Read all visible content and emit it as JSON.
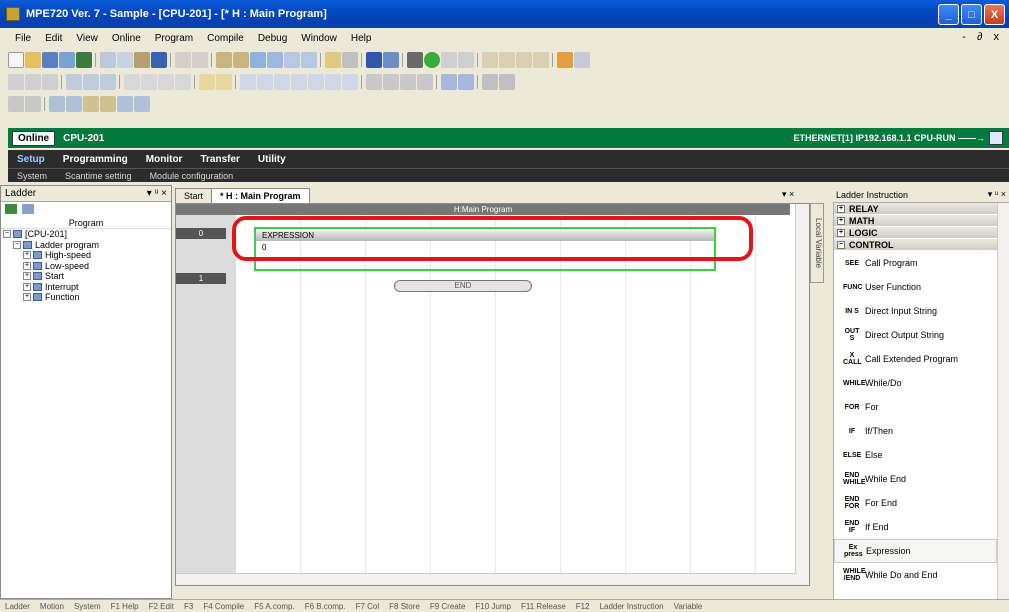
{
  "window": {
    "title": "MPE720 Ver. 7 - Sample - [CPU-201] - [* H : Main Program]",
    "min": "_",
    "max": "□",
    "close": "X"
  },
  "menu": {
    "items": [
      "File",
      "Edit",
      "View",
      "Online",
      "Program",
      "Compile",
      "Debug",
      "Window",
      "Help"
    ],
    "mdi_controls": "- ∂ x"
  },
  "online": {
    "button": "Online",
    "cpu": "CPU-201",
    "status": "ETHERNET[1] IP192.168.1.1 CPU-RUN ——→"
  },
  "main_tabs": [
    "Setup",
    "Programming",
    "Monitor",
    "Transfer",
    "Utility"
  ],
  "sub_tabs": [
    "System",
    "Scantime setting",
    "Module configuration"
  ],
  "ladder_panel": {
    "title": "Ladder",
    "pin": "▾ ᵘ ×",
    "program_label": "Program",
    "tree": [
      {
        "label": "[CPU-201]",
        "depth": 0
      },
      {
        "label": "Ladder program",
        "depth": 1
      },
      {
        "label": "High-speed",
        "depth": 2
      },
      {
        "label": "Low-speed",
        "depth": 2
      },
      {
        "label": "Start",
        "depth": 2
      },
      {
        "label": "Interrupt",
        "depth": 2
      },
      {
        "label": "Function",
        "depth": 2
      }
    ]
  },
  "doc_tabs": [
    "Start",
    "* H : Main Program"
  ],
  "doc_close": "▾ ×",
  "editor": {
    "header": "H:Main Program",
    "rung0": "0",
    "rung1": "1",
    "expression_label": "EXPRESSION",
    "expression_body": "0",
    "end_label": "END",
    "local_var_tab": "Local Variable"
  },
  "instruction_panel": {
    "title": "Ladder Instruction",
    "pin": "▾ ᵘ ×",
    "categories": [
      {
        "sign": "+",
        "name": "RELAY"
      },
      {
        "sign": "+",
        "name": "MATH"
      },
      {
        "sign": "+",
        "name": "LOGIC"
      },
      {
        "sign": "−",
        "name": "CONTROL"
      }
    ],
    "items": [
      {
        "icon": "SEE",
        "label": "Call Program"
      },
      {
        "icon": "FUNC",
        "label": "User Function"
      },
      {
        "icon": "IN S",
        "label": "Direct Input String"
      },
      {
        "icon": "OUT S",
        "label": "Direct Output String"
      },
      {
        "icon": "X CALL",
        "label": "Call Extended Program"
      },
      {
        "icon": "WHILE",
        "label": "While/Do"
      },
      {
        "icon": "FOR",
        "label": "For"
      },
      {
        "icon": "IF",
        "label": "If/Then"
      },
      {
        "icon": "ELSE",
        "label": "Else"
      },
      {
        "icon": "END WHILE",
        "label": "While End"
      },
      {
        "icon": "END FOR",
        "label": "For End"
      },
      {
        "icon": "END IF",
        "label": "If End"
      },
      {
        "icon": "Ex press",
        "label": "Expression"
      },
      {
        "icon": "WHILE /END",
        "label": "While Do and End"
      }
    ]
  },
  "statusbar": {
    "items": [
      "Ladder",
      "Motion",
      "System",
      "F1 Help",
      "F2 Edit",
      "F3",
      "F4 Compile",
      "F5 A.comp.",
      "F6 B.comp.",
      "F7 Col",
      "F8 Store",
      "F9 Create",
      "F10 Jump",
      "F11 Release",
      "F12",
      "Ladder Instruction",
      "Variable"
    ]
  },
  "colors": {
    "online_bar": "#007a3d",
    "highlight": "#e3151b",
    "expr_border": "#3fce3f"
  }
}
